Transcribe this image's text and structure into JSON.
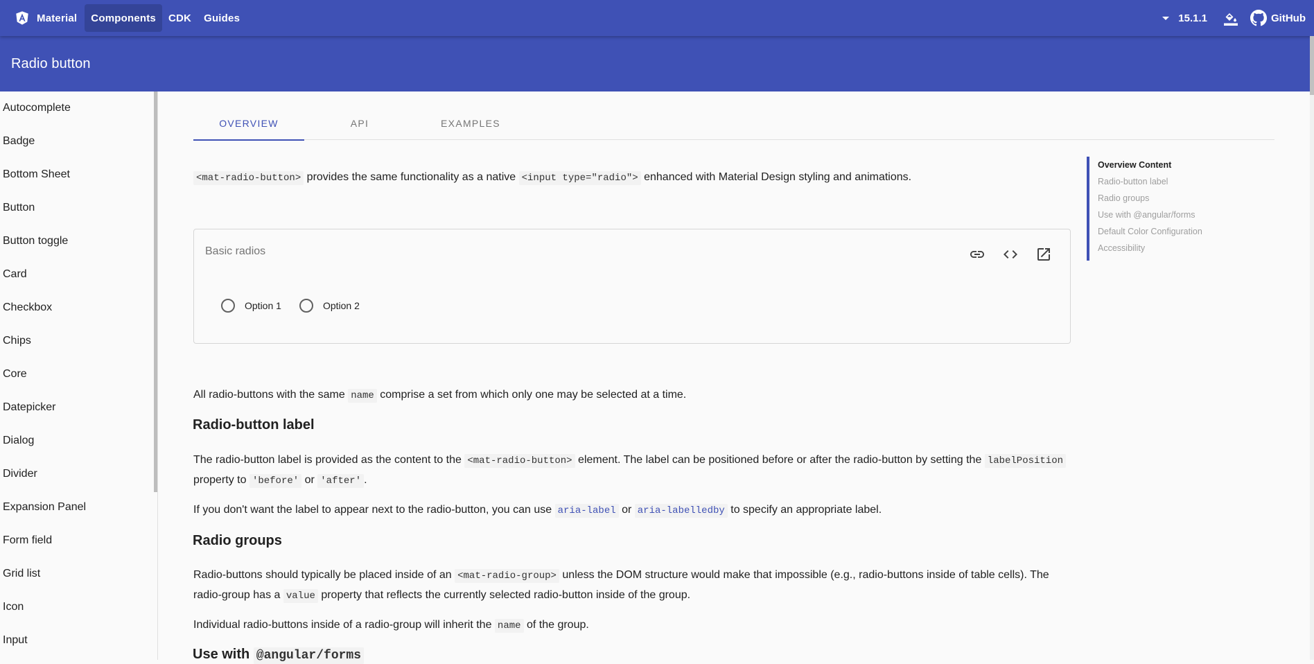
{
  "toolbar": {
    "brand": "Material",
    "nav": [
      "Components",
      "CDK",
      "Guides"
    ],
    "version": "15.1.1",
    "github": "GitHub",
    "color": "#3f51b5"
  },
  "header": {
    "title": "Radio button"
  },
  "sidebar": {
    "items": [
      "Autocomplete",
      "Badge",
      "Bottom Sheet",
      "Button",
      "Button toggle",
      "Card",
      "Checkbox",
      "Chips",
      "Core",
      "Datepicker",
      "Dialog",
      "Divider",
      "Expansion Panel",
      "Form field",
      "Grid list",
      "Icon",
      "Input"
    ]
  },
  "tabs": [
    "OVERVIEW",
    "API",
    "EXAMPLES"
  ],
  "intro": {
    "code1": "<mat-radio-button>",
    "t1": " provides the same functionality as a native ",
    "code2": "<input type=\"radio\">",
    "t2": " enhanced with Material Design styling and animations."
  },
  "example": {
    "title": "Basic radios",
    "options": [
      "Option 1",
      "Option 2"
    ],
    "icons": [
      "link-icon",
      "code-icon",
      "open-in-new-icon"
    ]
  },
  "sections": {
    "p_name": {
      "t1": "All radio-buttons with the same ",
      "code": "name",
      "t2": " comprise a set from which only one may be selected at a time."
    },
    "h_label": "Radio-button label",
    "p_label1": {
      "t1": "The radio-button label is provided as the content to the ",
      "code1": "<mat-radio-button>",
      "t2": " element. The label can be positioned before or after the radio-button by setting the ",
      "code2": "labelPosition",
      "t3": " property to ",
      "code3": "'before'",
      "t4": " or ",
      "code4": "'after'",
      "t5": "."
    },
    "p_label2": {
      "t1": "If you don't want the label to appear next to the radio-button, you can use ",
      "code1": "aria-label",
      "t2": " or ",
      "code2": "aria-labelledby",
      "t3": " to specify an appropriate label."
    },
    "h_groups": "Radio groups",
    "p_groups1": {
      "t1": "Radio-buttons should typically be placed inside of an ",
      "code1": "<mat-radio-group>",
      "t2": " unless the DOM structure would make that impossible (e.g., radio-buttons inside of table cells). The radio-group has a ",
      "code2": "value",
      "t3": " property that reflects the currently selected radio-button inside of the group."
    },
    "p_groups2": {
      "t1": "Individual radio-buttons inside of a radio-group will inherit the ",
      "code1": "name",
      "t2": " of the group."
    },
    "h_forms": {
      "t1": "Use with ",
      "code": "@angular/forms"
    }
  },
  "toc": [
    "Overview Content",
    "Radio-button label",
    "Radio groups",
    "Use with @angular/forms",
    "Default Color Configuration",
    "Accessibility"
  ]
}
